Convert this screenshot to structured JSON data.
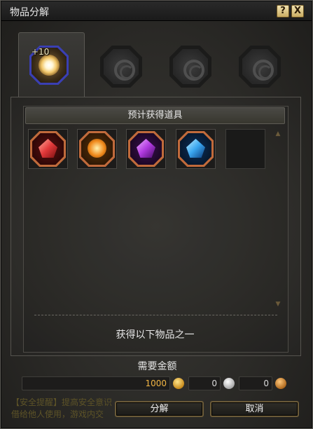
{
  "window": {
    "title": "物品分解"
  },
  "titlebar": {
    "help_label": "?",
    "close_label": "X"
  },
  "source_item": {
    "enhance_level": "+10"
  },
  "rewards": {
    "header": "预计获得道具",
    "footer": "获得以下物品之一",
    "items": [
      {
        "color": "#e2393a"
      },
      {
        "color": "#f08a1c"
      },
      {
        "color": "#b13be0"
      },
      {
        "color": "#3aa6f0"
      }
    ]
  },
  "cost": {
    "label": "需要金额",
    "gold": "1000",
    "silver": "0",
    "copper": "0"
  },
  "warning": "【安全提醒】提高安全意识\n借给他人使用，游戏内交",
  "buttons": {
    "disassemble": "分解",
    "cancel": "取消"
  }
}
